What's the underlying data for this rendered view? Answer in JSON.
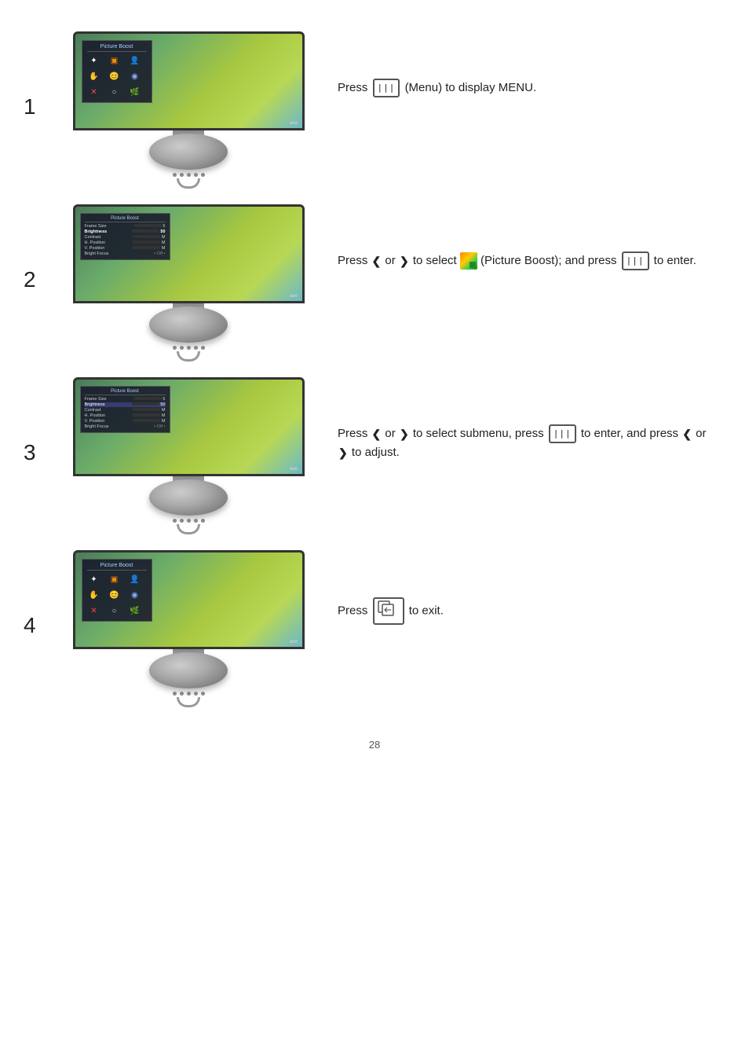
{
  "page": {
    "page_number": "28"
  },
  "steps": [
    {
      "number": "1",
      "instruction": {
        "parts": [
          "Press",
          "MENU_BTN",
          "(Menu) to display MENU."
        ]
      }
    },
    {
      "number": "2",
      "instruction": {
        "parts": [
          "Press",
          "CHEVRON_LEFT",
          "or",
          "CHEVRON_RIGHT",
          "to select",
          "PIC_BOOST",
          "(Picture Boost); and press",
          "MENU_BTN",
          "to enter."
        ]
      }
    },
    {
      "number": "3",
      "instruction": {
        "parts": [
          "Press",
          "CHEVRON_LEFT",
          "or",
          "CHEVRON_RIGHT",
          "to select submenu, press",
          "MENU_BTN",
          "to enter, and press",
          "CHEVRON_LEFT",
          "or",
          "CHEVRON_RIGHT",
          "to adjust."
        ]
      }
    },
    {
      "number": "4",
      "instruction": {
        "parts": [
          "Press",
          "EXIT_BTN",
          "to exit."
        ]
      }
    }
  ],
  "osd": {
    "title": "Picture Boost",
    "menu_title": "Picture Boost",
    "items": [
      {
        "label": "Frame Size",
        "value": "5",
        "bar": 50
      },
      {
        "label": "Brightness",
        "value": "50",
        "bar": 50
      },
      {
        "label": "Contrast",
        "value": "50",
        "bar": 50
      },
      {
        "label": "H. Position",
        "value": "50",
        "bar": 50
      },
      {
        "label": "V. Position",
        "value": "50",
        "bar": 50
      },
      {
        "label": "Bright Focus",
        "value": "Off",
        "bar": 0
      }
    ]
  }
}
